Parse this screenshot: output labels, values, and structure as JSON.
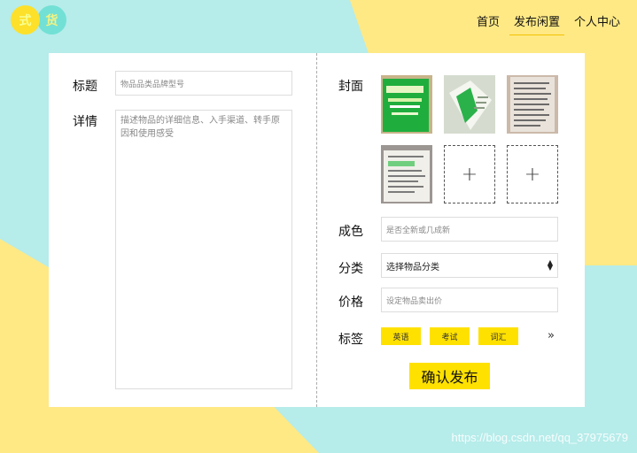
{
  "logo": {
    "char1": "式",
    "char2": "货"
  },
  "nav": {
    "home": "首页",
    "publish": "发布闲置",
    "profile": "个人中心"
  },
  "form": {
    "title_label": "标题",
    "title_placeholder": "物品品类品牌型号",
    "detail_label": "详情",
    "detail_placeholder": "描述物品的详细信息、入手渠道、转手原因和使用感受",
    "cover_label": "封面",
    "condition_label": "成色",
    "condition_placeholder": "是否全新或几成新",
    "category_label": "分类",
    "category_value": "选择物品分类",
    "price_label": "价格",
    "price_placeholder": "设定物品卖出价",
    "tags_label": "标签",
    "tags": [
      "英语",
      "考试",
      "词汇"
    ],
    "more_symbol": "»",
    "upload_symbol": "+",
    "submit": "确认发布"
  },
  "watermark": "https://blog.csdn.net/qq_37975679",
  "colors": {
    "accent": "#ffe100",
    "bg_yellow": "#ffe985",
    "bg_cyan": "#b6ecea"
  }
}
